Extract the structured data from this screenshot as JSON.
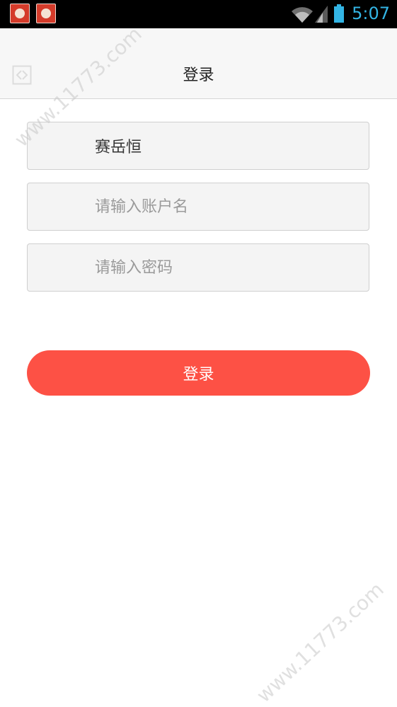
{
  "status_bar": {
    "time": "5:07",
    "accent_color": "#33b5e5"
  },
  "header": {
    "title": "登录"
  },
  "form": {
    "school_value": "赛岳恒",
    "username_placeholder": "请输入账户名",
    "password_placeholder": "请输入密码",
    "submit_label": "登录",
    "button_color": "#fd5145"
  },
  "watermark": {
    "text": "www.11773.com"
  }
}
